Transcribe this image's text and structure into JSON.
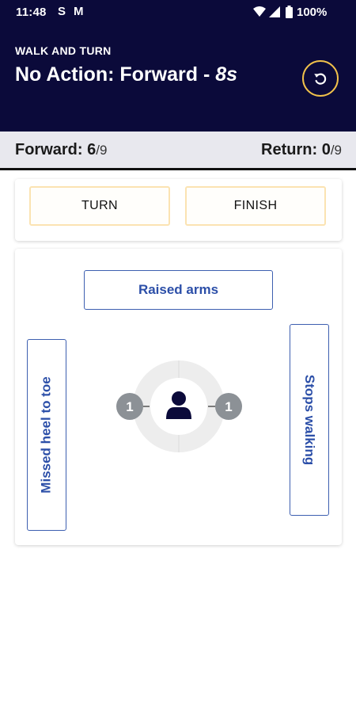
{
  "status_bar": {
    "time": "11:48",
    "s_glyph": "S",
    "m_glyph": "M",
    "battery": "100%"
  },
  "header": {
    "subtitle": "WALK AND TURN",
    "title_prefix": "No Action: Forward - ",
    "title_time": "8s",
    "reset_icon": "rotate-ccw-icon"
  },
  "counters": {
    "forward_label": "Forward: ",
    "forward_value": "6",
    "forward_total": "/9",
    "return_label": "Return: ",
    "return_value": "0",
    "return_total": "/9"
  },
  "actions": {
    "turn": "TURN",
    "finish": "FINISH"
  },
  "deviations": {
    "raised_arms": "Raised arms",
    "missed_heel_to_toe": "Missed heel to toe",
    "stops_walking": "Stops walking",
    "left_count": "1",
    "right_count": "1",
    "center_icon": "person-icon"
  },
  "colors": {
    "header_bg": "#0b0a3a",
    "accent_yellow": "#f0c14b",
    "deviation_blue": "#2c4fa8",
    "counter_bg": "#e8e8ee"
  }
}
